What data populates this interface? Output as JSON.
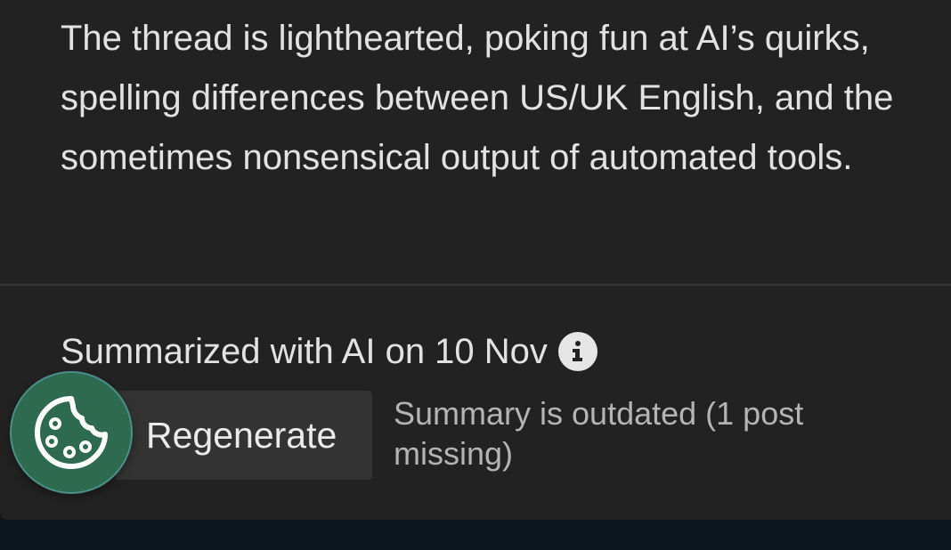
{
  "summary": {
    "body": "The thread is lighthearted, poking fun at AI’s quirks, spelling differences between US/UK English, and the sometimes nonsensical output of automated tools."
  },
  "footer": {
    "summarized_label": "Summarized with AI on 10 Nov",
    "info_icon": "info-icon",
    "regenerate_label": "Regenerate",
    "outdated_text": "Summary is outdated (1 post missing)"
  },
  "fab": {
    "icon": "cookie-icon"
  },
  "colors": {
    "panel_background": "#222222",
    "page_background": "#0d161c",
    "primary_text": "#e2e2e2",
    "secondary_text": "#b4b4b4",
    "button_background": "#333333",
    "fab_background": "#2d6a4f",
    "fab_border": "#4a8f8a"
  }
}
